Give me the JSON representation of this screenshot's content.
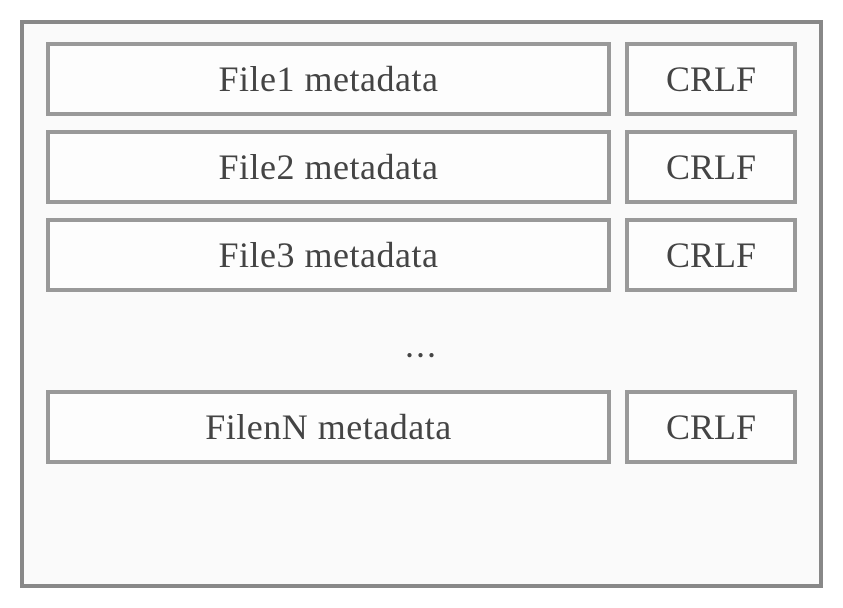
{
  "rows": [
    {
      "metadata": "File1 metadata",
      "terminator": "CRLF"
    },
    {
      "metadata": "File2 metadata",
      "terminator": "CRLF"
    },
    {
      "metadata": "File3 metadata",
      "terminator": "CRLF"
    }
  ],
  "ellipsis": "...",
  "final_row": {
    "metadata": "FilenN metadata",
    "terminator": "CRLF"
  }
}
